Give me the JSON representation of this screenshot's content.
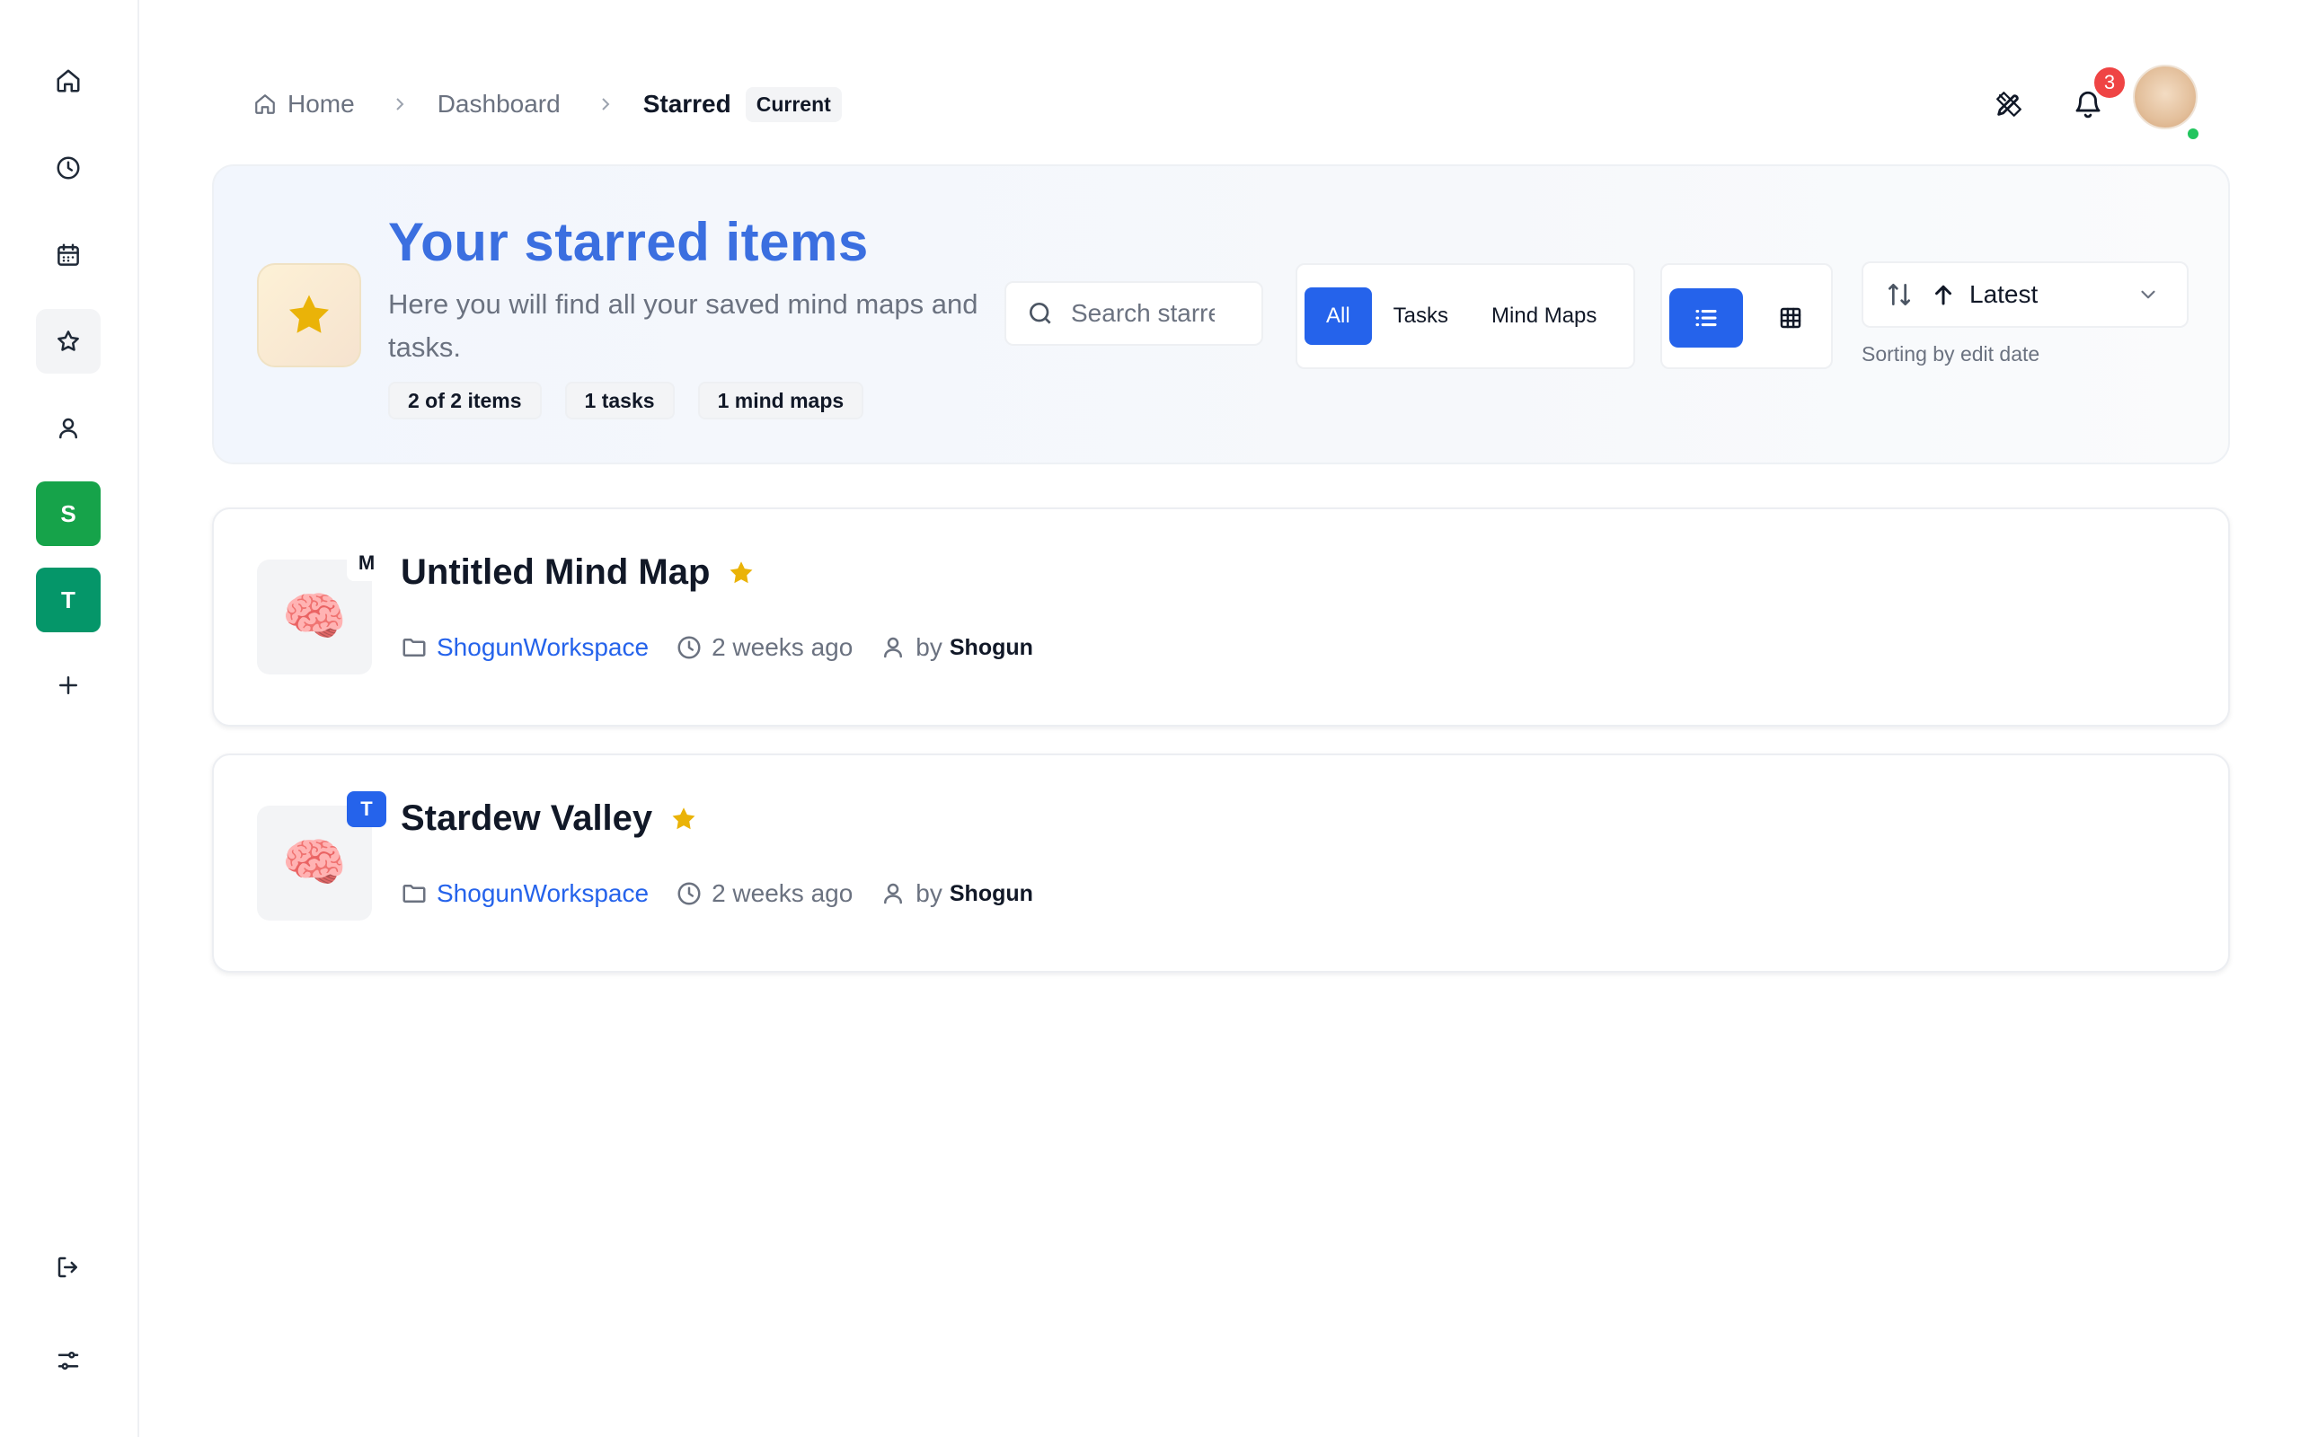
{
  "sidebar": {
    "icons": [
      "home-icon",
      "clock-icon",
      "calendar-icon",
      "star-icon",
      "user-icon",
      "plus-icon",
      "logout-icon",
      "settings-sliders-icon"
    ],
    "workspaces": [
      {
        "letter": "S",
        "color": "#16a34a"
      },
      {
        "letter": "T",
        "color": "#059669"
      }
    ]
  },
  "breadcrumb": {
    "home": "Home",
    "dashboard": "Dashboard",
    "current": "Starred",
    "current_tag": "Current"
  },
  "header": {
    "notifications_count": "3"
  },
  "hero": {
    "title": "Your starred items",
    "subtitle": "Here you will find all your saved mind maps and tasks.",
    "chips": {
      "count": "2 of 2 items",
      "tasks": "1 tasks",
      "mindmaps": "1 mind maps"
    },
    "search_placeholder": "Search starred...",
    "filters": {
      "all": "All",
      "tasks": "Tasks",
      "mindmaps": "Mind Maps",
      "active": "All"
    },
    "view_mode": "list",
    "sort": {
      "label": "Latest",
      "hint": "Sorting by edit date"
    }
  },
  "items": [
    {
      "type_badge": "M",
      "title": "Untitled Mind Map",
      "workspace": "ShogunWorkspace",
      "time": "2 weeks ago",
      "by": "by",
      "author": "Shogun"
    },
    {
      "type_badge": "T",
      "title": "Stardew Valley",
      "workspace": "ShogunWorkspace",
      "time": "2 weeks ago",
      "by": "by",
      "author": "Shogun"
    }
  ],
  "colors": {
    "accent": "#2563eb",
    "title": "#3b6fe0",
    "star": "#eab308",
    "badge": "#ef4444",
    "online": "#22c55e"
  }
}
